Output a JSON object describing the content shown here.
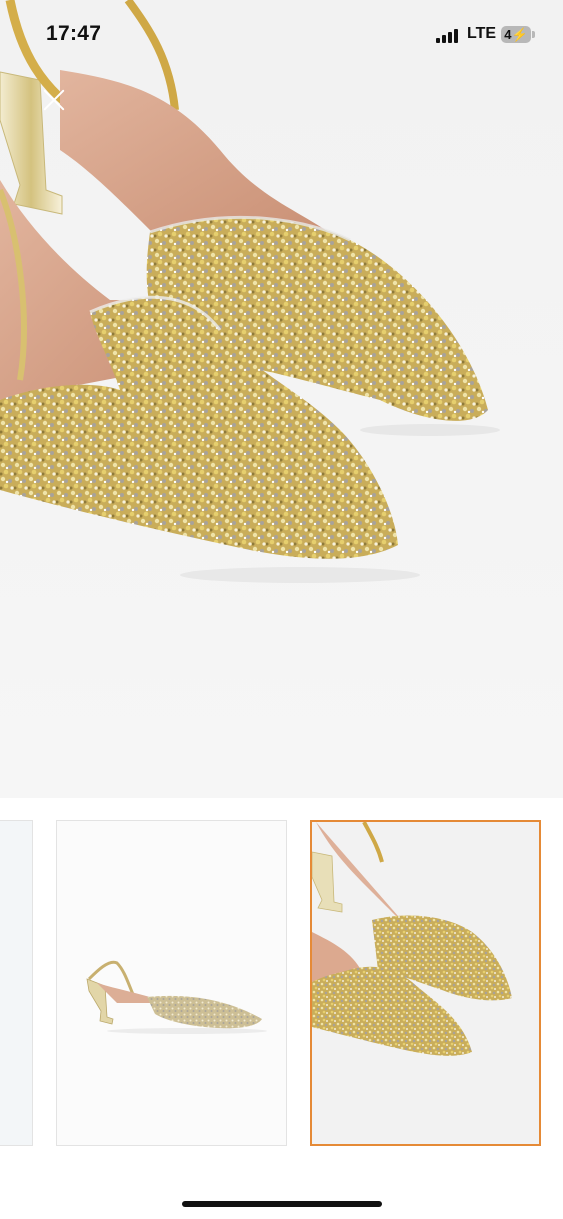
{
  "status_bar": {
    "time": "17:47",
    "network": "LTE",
    "battery": "4"
  },
  "gallery": {
    "main_image": "gold-rhinestone-pointed-slingback-heels-closeup",
    "thumbnails": [
      {
        "content": "partial-thumbnail",
        "selected": false
      },
      {
        "content": "single-shoe-side-view",
        "selected": false
      },
      {
        "content": "pair-closeup",
        "selected": true
      }
    ],
    "selected_border_color": "#e58a36"
  },
  "colors": {
    "sparkle_gold": "#c9a94a",
    "sparkle_silver": "#b9b4a8",
    "leather_lining": "#d8a58c",
    "heel_metal": "#d9c98a"
  }
}
